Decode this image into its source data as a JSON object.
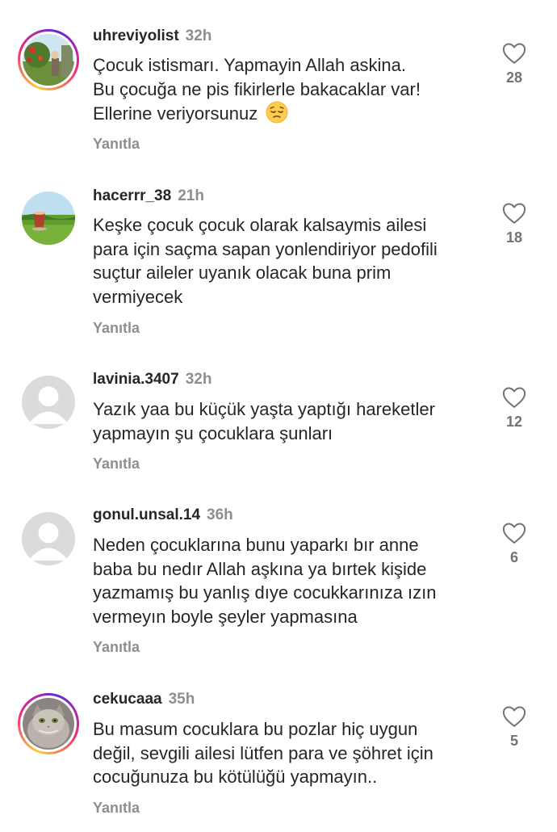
{
  "comments": [
    {
      "username": "uhreviyolist",
      "time": "32h",
      "text": "Çocuk istismarı.  Yapmayin Allah askina.\nBu çocuğa ne pis fikirlerle bakacaklar var!\nEllerine veriyorsunuz",
      "emoji": "pensive-face",
      "likes": "28",
      "reply_label": "Yanıtla",
      "avatar": "landscape-photo",
      "story_ring": true
    },
    {
      "username": "hacerrr_38",
      "time": "21h",
      "text": "Keşke çocuk çocuk olarak kalsaymis ailesi\npara için saçma sapan yonlendiriyor pedofili\nsuçtur aileler uyanık olacak buna prim\nvermiyecek",
      "likes": "18",
      "reply_label": "Yanıtla",
      "avatar": "tea-glass-photo",
      "story_ring": false
    },
    {
      "username": "lavinia.3407",
      "time": "32h",
      "text": "Yazık yaa bu küçük yaşta yaptığı hareketler\nyapmayın şu çocuklara şunları",
      "likes": "12",
      "reply_label": "Yanıtla",
      "avatar": "default-avatar",
      "story_ring": false
    },
    {
      "username": "gonul.unsal.14",
      "time": "36h",
      "text": "Neden çocuklarına bunu yaparkı bır anne\nbaba bu nedır Allah aşkına ya bırtek kişide\nyazmamış bu yanlış dıye cocukkarınıza ızın\nvermeyın boyle şeyler yapmasına",
      "likes": "6",
      "reply_label": "Yanıtla",
      "avatar": "default-avatar",
      "story_ring": false
    },
    {
      "username": "cekucaaa",
      "time": "35h",
      "text": "Bu masum cocuklara bu pozlar hiç uygun\ndeğil, sevgili ailesi lütfen para ve şöhret için\ncocuğunuza bu kötülüğü yapmayın..",
      "likes": "5",
      "reply_label": "Yanıtla",
      "avatar": "cat-photo",
      "story_ring": true
    }
  ],
  "colors": {
    "text_primary": "#262626",
    "text_secondary": "#8e8e8e",
    "heart_outline": "#737373",
    "default_avatar_bg": "#dbdbdb"
  }
}
